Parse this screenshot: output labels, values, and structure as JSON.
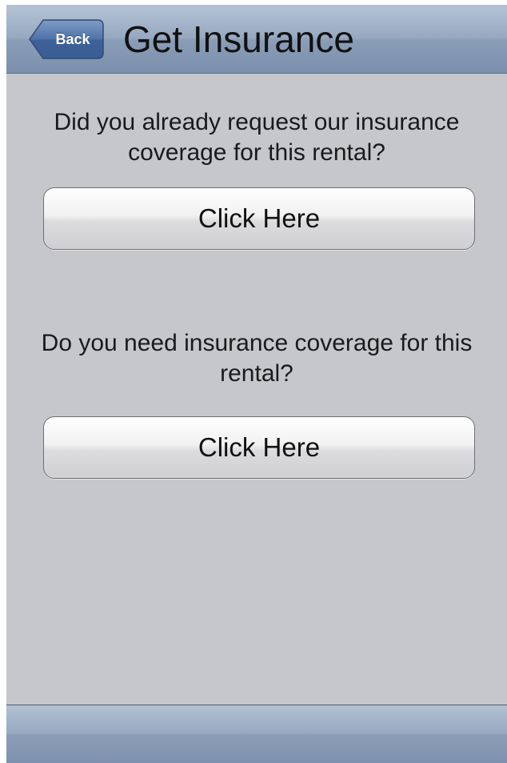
{
  "navbar": {
    "back_label": "Back",
    "title": "Get Insurance"
  },
  "main": {
    "question_1": "Did you already request our insurance coverage for this rental?",
    "button_1_label": "Click Here",
    "question_2": "Do you need insurance coverage for this rental?",
    "button_2_label": "Click Here"
  },
  "colors": {
    "navbar": "#8a9db7",
    "background": "#c6c7cb",
    "back_button": "#4f6f9f"
  }
}
